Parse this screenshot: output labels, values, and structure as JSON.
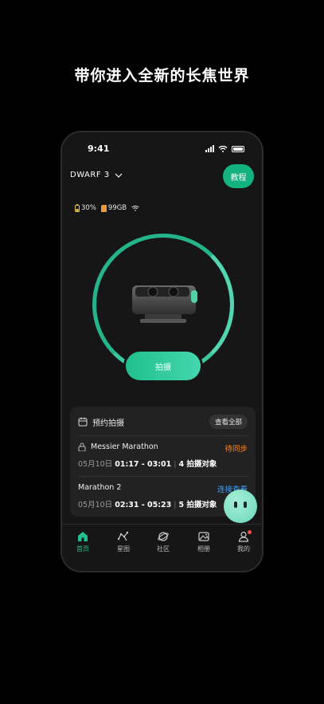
{
  "headline": "带你进入全新的长焦世界",
  "status_bar": {
    "time": "9:41"
  },
  "header": {
    "device_name": "DWARF 3",
    "tutorial_label": "教程"
  },
  "stats": {
    "battery": "30%",
    "storage": "99GB"
  },
  "shoot_label": "拍摄",
  "schedule": {
    "title": "预约拍摄",
    "view_all": "查看全部",
    "items": [
      {
        "name": "Messier Marathon",
        "status": "待同步",
        "date": "05月10日",
        "time": "01:17 - 03:01",
        "targets": "4 拍摄对象"
      },
      {
        "name": "Marathon 2",
        "status": "连接查看",
        "date": "05月10日",
        "time": "02:31 - 05:23",
        "targets": "5 拍摄对象"
      }
    ]
  },
  "tabs": [
    "首页",
    "星图",
    "社区",
    "相册",
    "我的"
  ],
  "colors": {
    "accent": "#14b27f",
    "pending": "#ff8a1f",
    "link": "#3aa3ff"
  }
}
